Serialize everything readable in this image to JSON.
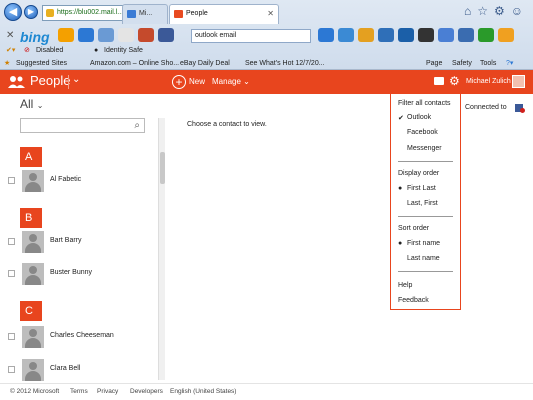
{
  "browser": {
    "address": "https://blu002.mail.l...",
    "tab_inactive": "Mi...",
    "tab_active": "People",
    "search_value": "outlook email",
    "bing": "bing",
    "disabled": "Disabled",
    "identity_safe": "Identity Safe",
    "favorites": {
      "suggested": "Suggested Sites",
      "amazon": "Amazon.com – Online Sho...",
      "ebay": "eBay Daily Deal",
      "see_whats_hot": "See What's Hot 12/7/20..."
    },
    "toolbar": {
      "page": "Page",
      "safety": "Safety",
      "tools": "Tools"
    }
  },
  "app": {
    "title": "People",
    "new_label": "New",
    "manage_label": "Manage",
    "user_name": "Michael Zulich"
  },
  "left": {
    "filter_label": "All",
    "groups": [
      {
        "letter": "A",
        "contacts": [
          "Al Fabetic"
        ]
      },
      {
        "letter": "B",
        "contacts": [
          "Bart Barry",
          "Buster Bunny"
        ]
      },
      {
        "letter": "C",
        "contacts": [
          "Charles Cheeseman",
          "Clara Bell"
        ]
      }
    ]
  },
  "main": {
    "placeholder": "Choose a contact to view.",
    "connected": "Connected to"
  },
  "menu": {
    "filter_head": "Filter all contacts",
    "filter_options": [
      "Outlook",
      "Facebook",
      "Messenger"
    ],
    "display_head": "Display order",
    "display_options": [
      "First Last",
      "Last, First"
    ],
    "sort_head": "Sort order",
    "sort_options": [
      "First name",
      "Last name"
    ],
    "help": "Help",
    "feedback": "Feedback"
  },
  "footer": {
    "copyright": "© 2012 Microsoft",
    "terms": "Terms",
    "privacy": "Privacy",
    "developers": "Developers",
    "language": "English (United States)"
  },
  "colors": {
    "accent": "#e8451e"
  }
}
